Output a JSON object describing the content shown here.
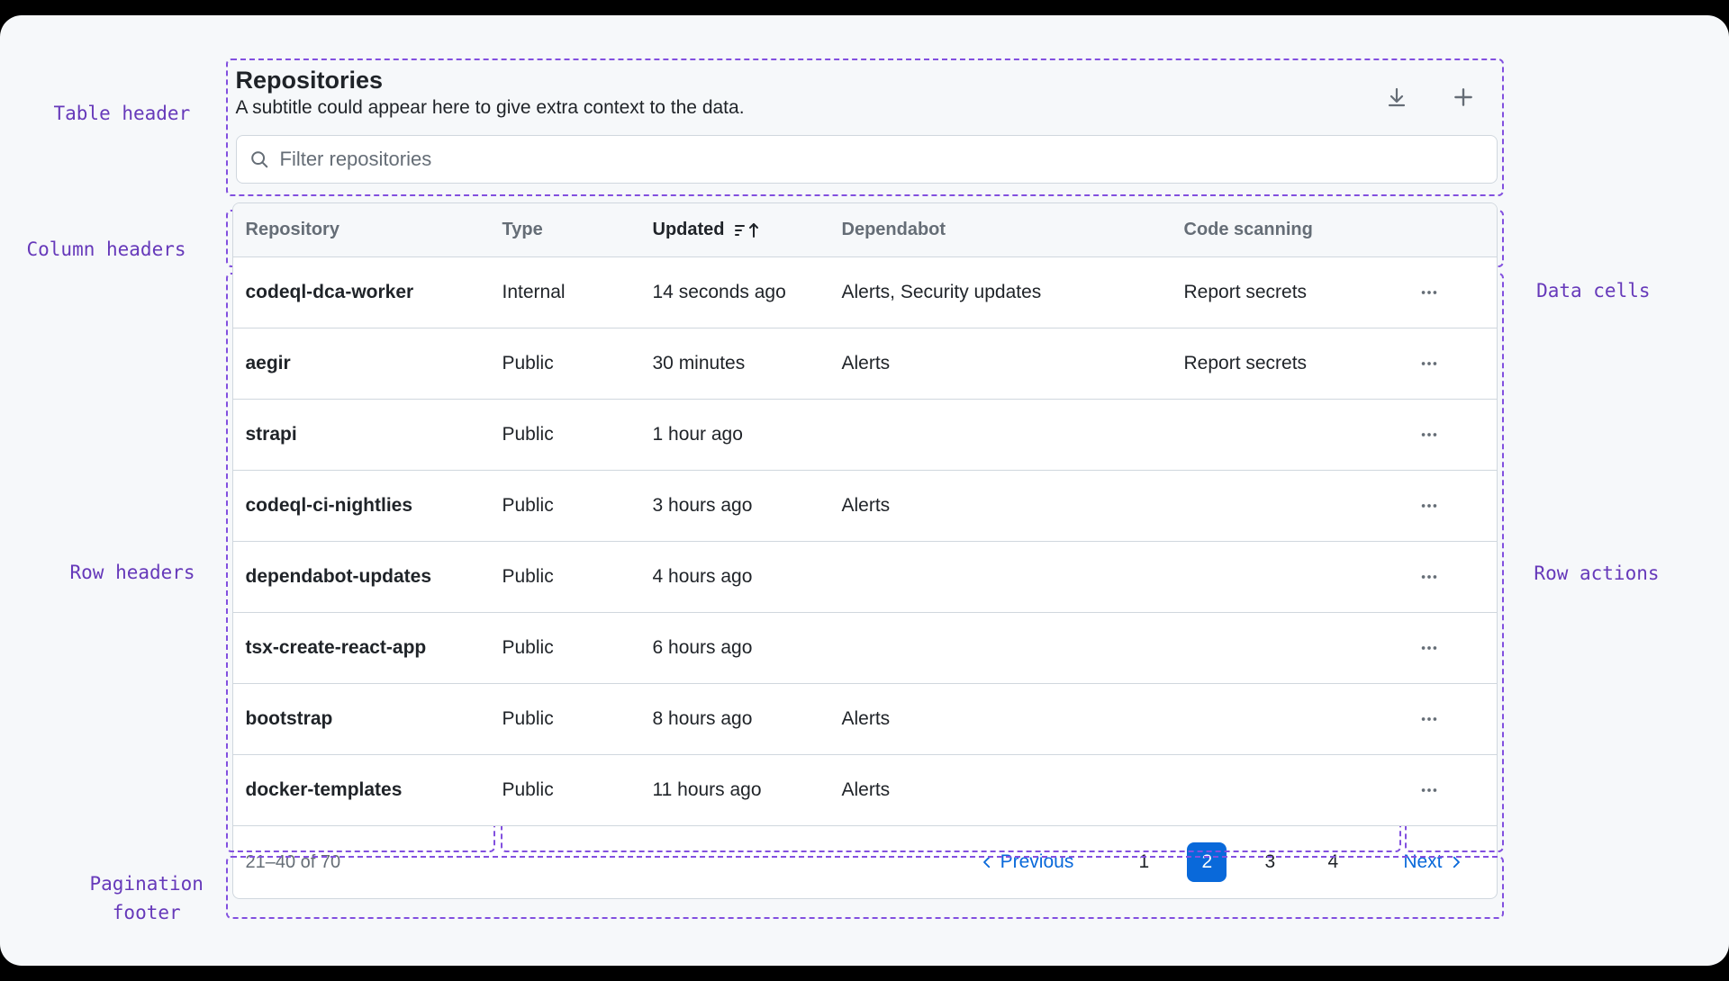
{
  "header": {
    "title": "Repositories",
    "subtitle": "A subtitle could appear here to give extra context to the data.",
    "search_placeholder": "Filter repositories"
  },
  "columns": {
    "repository": "Repository",
    "type": "Type",
    "updated": "Updated",
    "dependabot": "Dependabot",
    "code_scanning": "Code scanning"
  },
  "rows": [
    {
      "repo": "codeql-dca-worker",
      "type": "Internal",
      "updated": "14 seconds ago",
      "dependabot": "Alerts, Security updates",
      "code_scanning": "Report secrets"
    },
    {
      "repo": "aegir",
      "type": "Public",
      "updated": "30 minutes",
      "dependabot": "Alerts",
      "code_scanning": "Report secrets"
    },
    {
      "repo": "strapi",
      "type": "Public",
      "updated": "1 hour ago",
      "dependabot": "",
      "code_scanning": ""
    },
    {
      "repo": "codeql-ci-nightlies",
      "type": "Public",
      "updated": "3 hours ago",
      "dependabot": "Alerts",
      "code_scanning": ""
    },
    {
      "repo": "dependabot-updates",
      "type": "Public",
      "updated": "4 hours ago",
      "dependabot": "",
      "code_scanning": ""
    },
    {
      "repo": "tsx-create-react-app",
      "type": "Public",
      "updated": "6 hours ago",
      "dependabot": "",
      "code_scanning": ""
    },
    {
      "repo": "bootstrap",
      "type": "Public",
      "updated": "8 hours ago",
      "dependabot": "Alerts",
      "code_scanning": ""
    },
    {
      "repo": "docker-templates",
      "type": "Public",
      "updated": "11 hours ago",
      "dependabot": "Alerts",
      "code_scanning": ""
    }
  ],
  "pagination": {
    "summary": "21–40 of 70",
    "prev": "Previous",
    "next": "Next",
    "pages": [
      "1",
      "2",
      "3",
      "4"
    ],
    "active": "2"
  },
  "annotations": {
    "table_header": "Table header",
    "column_headers": "Column headers",
    "row_headers": "Row headers",
    "pagination_footer_l1": "Pagination",
    "pagination_footer_l2": "footer",
    "data_cells": "Data cells",
    "row_actions": "Row actions"
  }
}
